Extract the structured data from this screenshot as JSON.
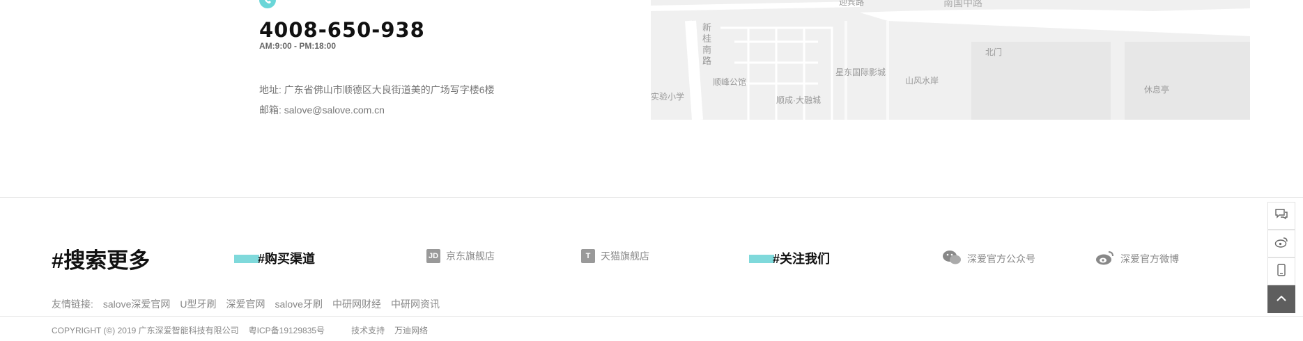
{
  "contact": {
    "phone": "4008-650-938",
    "hours": "AM:9:00 - PM:18:00",
    "address": "地址: 广东省佛山市顺德区大良街道美的广场写字楼6楼",
    "email": "邮箱: salove@salove.com.cn"
  },
  "map": {
    "labels": [
      "南国中路",
      "新桂南路",
      "顺峰公馆",
      "星东国际影城",
      "山风水岸",
      "顺成·大融城",
      "北门",
      "休息亭",
      "实验小学",
      "迎宾路"
    ]
  },
  "footer": {
    "search_more": "#搜索更多",
    "buy_channels": "#购买渠道",
    "jd_store": "京东旗舰店",
    "tmall_store": "天猫旗舰店",
    "follow_us": "#关注我们",
    "wechat": "深爱官方公众号",
    "weibo": "深爱官方微博",
    "friend_links_label": "友情链接:",
    "friend_links": [
      "salove深爱官网",
      "U型牙刷",
      "深爱官网",
      "salove牙刷",
      "中研网财经",
      "中研网资讯"
    ],
    "copyright": "COPYRIGHT (©) 2019 广东深爱智能科技有限公司",
    "icp": "粤ICP备19129835号",
    "tech_support_label": "技术支持",
    "tech_support": "万迪网络"
  },
  "colors": {
    "accent": "#7fd9db",
    "toolbar_top": "#5e5e5e"
  },
  "icons": [
    "phone-icon",
    "jd-icon",
    "tmall-icon",
    "wechat-icon",
    "weibo-icon",
    "chat-icon",
    "mobile-icon",
    "chevron-up-icon"
  ]
}
